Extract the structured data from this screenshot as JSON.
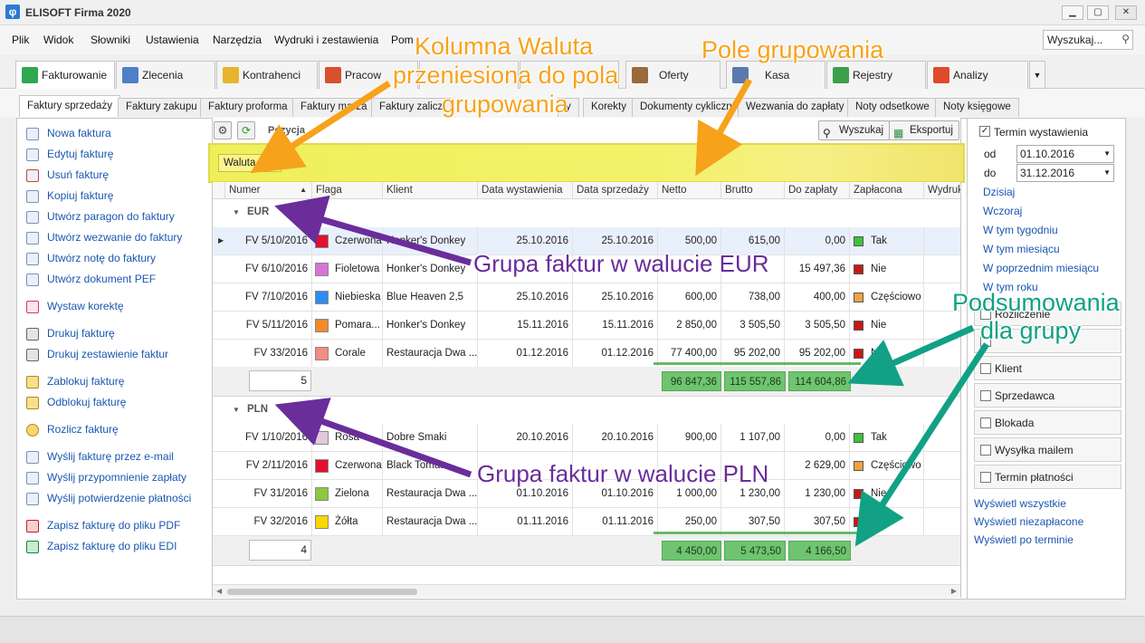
{
  "window": {
    "title": "ELISOFT Firma 2020"
  },
  "menu": [
    "Plik",
    "Widok",
    "Słowniki",
    "Ustawienia",
    "Narzędzia",
    "Wydruki i zestawienia",
    "Pom"
  ],
  "search": {
    "placeholder": "Wyszukaj..."
  },
  "ribbon_tabs": [
    "Fakturowanie",
    "Zlecenia",
    "Kontrahenci",
    "Pracow",
    "",
    "",
    "Oferty",
    "Kasa",
    "Rejestry",
    "Analizy"
  ],
  "sub_tabs": [
    "Faktury sprzedaży",
    "Faktury zakupu",
    "Faktury proforma",
    "Faktury marża",
    "Faktury zalicz",
    "y",
    "Korekty",
    "Dokumenty cykliczne",
    "Wezwania do zapłaty",
    "Noty odsetkowe",
    "Noty księgowe"
  ],
  "actions": [
    "Nowa faktura",
    "Edytuj fakturę",
    "Usuń fakturę",
    "Kopiuj fakturę",
    "Utwórz paragon do faktury",
    "Utwórz wezwanie do faktury",
    "Utwórz notę do faktury",
    "Utwórz dokument PEF",
    "Wystaw korektę",
    "Drukuj fakturę",
    "Drukuj zestawienie faktur",
    "Zablokuj fakturę",
    "Odblokuj fakturę",
    "Rozlicz fakturę",
    "Wyślij fakturę przez e-mail",
    "Wyślij przypomnienie zapłaty",
    "Wyślij potwierdzenie płatności",
    "Zapisz fakturę do pliku PDF",
    "Zapisz fakturę do pliku EDI"
  ],
  "toolbar": {
    "position_label": "Pozycja",
    "search_btn": "Wyszukaj",
    "export_btn": "Eksportuj"
  },
  "group_chip": "Waluta",
  "columns": [
    "Numer",
    "Flaga",
    "Klient",
    "Data wystawienia",
    "Data sprzedaży",
    "Netto",
    "Brutto",
    "Do zapłaty",
    "Zapłacona",
    "Wydruk"
  ],
  "groups": [
    {
      "name": "EUR",
      "rows": [
        {
          "numer": "FV 5/10/2016",
          "flaga": "Czerwona",
          "flag_color": "#e0102e",
          "klient": "Honker's Donkey",
          "data_wyst": "25.10.2016",
          "data_sprz": "25.10.2016",
          "netto": "500,00",
          "brutto": "615,00",
          "do_zaplaty": "0,00",
          "zaplacona": "Tak",
          "paid_color": "#3cc23c"
        },
        {
          "numer": "FV 6/10/2016",
          "flaga": "Fioletowa",
          "flag_color": "#d872d8",
          "klient": "Honker's Donkey",
          "data_wyst": "",
          "data_sprz": "",
          "netto": "",
          "brutto": "",
          "do_zaplaty": "15 497,36",
          "zaplacona": "Nie",
          "paid_color": "#c81818"
        },
        {
          "numer": "FV 7/10/2016",
          "flaga": "Niebieska",
          "flag_color": "#2e8cf0",
          "klient": "Blue Heaven 2,5",
          "data_wyst": "25.10.2016",
          "data_sprz": "25.10.2016",
          "netto": "600,00",
          "brutto": "738,00",
          "do_zaplaty": "400,00",
          "zaplacona": "Częściowo",
          "paid_color": "#f0a23a"
        },
        {
          "numer": "FV 5/11/2016",
          "flaga": "Pomara...",
          "flag_color": "#f08a2a",
          "klient": "Honker's Donkey",
          "data_wyst": "15.11.2016",
          "data_sprz": "15.11.2016",
          "netto": "2 850,00",
          "brutto": "3 505,50",
          "do_zaplaty": "3 505,50",
          "zaplacona": "Nie",
          "paid_color": "#c81818"
        },
        {
          "numer": "FV 33/2016",
          "flaga": "Corale",
          "flag_color": "#f28c84",
          "klient": "Restauracja Dwa ...",
          "data_wyst": "01.12.2016",
          "data_sprz": "01.12.2016",
          "netto": "77 400,00",
          "brutto": "95 202,00",
          "do_zaplaty": "95 202,00",
          "zaplacona": "Nie",
          "paid_color": "#c81818"
        }
      ],
      "count": "5",
      "sum_netto": "96 847,36",
      "sum_brutto": "115 557,86",
      "sum_do_zaplaty": "114 604,86"
    },
    {
      "name": "PLN",
      "rows": [
        {
          "numer": "FV 1/10/2016",
          "flaga": "Rosa",
          "flag_color": "#e2c8dc",
          "klient": "Dobre Smaki",
          "data_wyst": "20.10.2016",
          "data_sprz": "20.10.2016",
          "netto": "900,00",
          "brutto": "1 107,00",
          "do_zaplaty": "0,00",
          "zaplacona": "Tak",
          "paid_color": "#3cc23c"
        },
        {
          "numer": "FV 2/11/2016",
          "flaga": "Czerwona",
          "flag_color": "#e0102e",
          "klient": "Black Tomat",
          "data_wyst": "",
          "data_sprz": "",
          "netto": "",
          "brutto": "",
          "do_zaplaty": "2 629,00",
          "zaplacona": "Częściowo",
          "paid_color": "#f0a23a"
        },
        {
          "numer": "FV 31/2016",
          "flaga": "Zielona",
          "flag_color": "#8cc83c",
          "klient": "Restauracja Dwa ...",
          "data_wyst": "01.10.2016",
          "data_sprz": "01.10.2016",
          "netto": "1 000,00",
          "brutto": "1 230,00",
          "do_zaplaty": "1 230,00",
          "zaplacona": "Nie",
          "paid_color": "#c81818"
        },
        {
          "numer": "FV 32/2016",
          "flaga": "Żółta",
          "flag_color": "#f8d800",
          "klient": "Restauracja Dwa ...",
          "data_wyst": "01.11.2016",
          "data_sprz": "01.11.2016",
          "netto": "250,00",
          "brutto": "307,50",
          "do_zaplaty": "307,50",
          "zaplacona": "Nie",
          "paid_color": "#c81818"
        }
      ],
      "count": "4",
      "sum_netto": "4 450,00",
      "sum_brutto": "5 473,50",
      "sum_do_zaplaty": "4 166,50"
    }
  ],
  "filters": {
    "termin_label": "Termin wystawienia",
    "od_label": "od",
    "od_value": "01.10.2016",
    "do_label": "do",
    "do_value": "31.12.2016",
    "quick": [
      "Dzisiaj",
      "Wczoraj",
      "W tym tygodniu",
      "W tym miesiącu",
      "W poprzednim miesiącu",
      "W tym roku"
    ],
    "checkbox_filters": [
      "Rozliczenie",
      "",
      "Klient",
      "Sprzedawca",
      "Blokada",
      "Wysyłka mailem",
      "Termin płatności"
    ],
    "bottom_links": [
      "Wyświetl wszystkie",
      "Wyświetl niezapłacone",
      "Wyświetl po terminie"
    ]
  },
  "annotations": {
    "kolumna_line1": "Kolumna Waluta",
    "kolumna_line2": "przeniesiona do pola",
    "kolumna_line3": "grupowania",
    "pole": "Pole grupowania",
    "grupa_eur": "Grupa faktur w walucie EUR",
    "grupa_pln": "Grupa faktur w walucie PLN",
    "podsum_line1": "Podsumowania",
    "podsum_line2": "dla grupy"
  },
  "colors": {
    "annotation_orange": "#f7a21b",
    "annotation_purple": "#6a2d9a",
    "annotation_green": "#12a185",
    "group_panel": "#eef05a",
    "summary_green": "#6fc46f"
  }
}
